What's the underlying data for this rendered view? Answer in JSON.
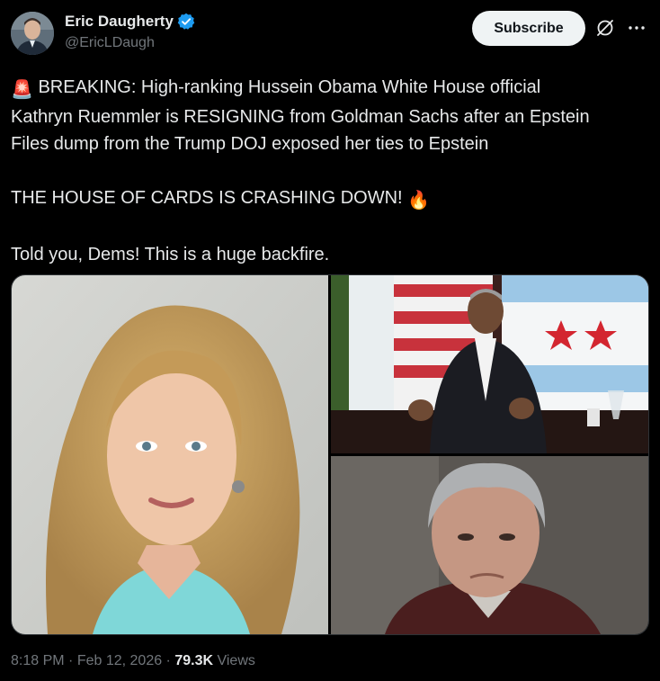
{
  "author": {
    "display_name": "Eric Daugherty",
    "handle": "@EricLDaugh",
    "avatar_icon": "profile-photo",
    "verified_icon": "verified-badge-icon",
    "verified_color": "#1d9bf0"
  },
  "actions": {
    "subscribe_label": "Subscribe",
    "grok_icon": "grok-icon",
    "more_icon": "more-options-icon"
  },
  "tweet": {
    "line1_emoji": "🚨",
    "line1": " BREAKING: High-ranking Hussein Obama White House official",
    "line2": "Kathryn Ruemmler is RESIGNING from Goldman Sachs after an Epstein",
    "line3": "Files dump from the Trump DOJ exposed her ties to Epstein",
    "line4": "THE HOUSE OF CARDS IS CRASHING DOWN! ",
    "line4_emoji": "🔥",
    "line5": "Told you, Dems! This is a huge backfire."
  },
  "meta": {
    "time": "8:18 PM",
    "sep1": " · ",
    "date": "Feb 12, 2026",
    "sep2": " · ",
    "views_count": "79.3K",
    "views_label": " Views"
  },
  "colors": {
    "background": "#000000",
    "text": "#e7e9ea",
    "secondary": "#71767b",
    "border": "#2f3336",
    "subscribe_bg": "#eff3f4"
  }
}
